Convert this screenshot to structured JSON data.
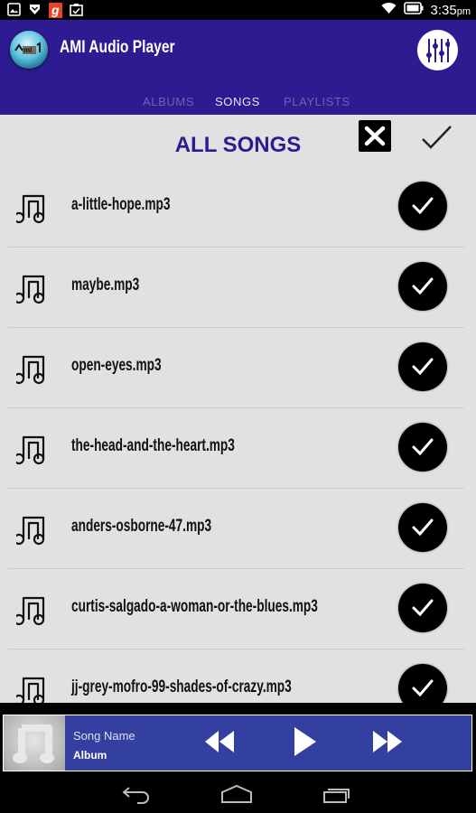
{
  "status_bar": {
    "left_icons": [
      "image-icon",
      "download-shield-icon",
      "gaana-app-icon",
      "clipboard-check-icon"
    ],
    "right_icons": [
      "wifi-icon",
      "battery-icon"
    ],
    "time": "3:35",
    "ampm": "pm"
  },
  "app_bar": {
    "title": "AMI Audio Player",
    "logo_text": "AMI",
    "equalizer_icon": "equalizer-icon"
  },
  "tabs": [
    {
      "label": "ALBUMS",
      "active": false
    },
    {
      "label": "SONGS",
      "active": true
    },
    {
      "label": "PLAYLISTS",
      "active": false
    }
  ],
  "content": {
    "title": "ALL SONGS",
    "close_icon": "close-icon",
    "confirm_icon": "check-icon"
  },
  "songs": [
    {
      "name": "a-little-hope.mp3",
      "selected": true
    },
    {
      "name": "maybe.mp3",
      "selected": true
    },
    {
      "name": "open-eyes.mp3",
      "selected": true
    },
    {
      "name": "the-head-and-the-heart.mp3",
      "selected": true
    },
    {
      "name": "anders-osborne-47.mp3",
      "selected": true
    },
    {
      "name": "curtis-salgado-a-woman-or-the-blues.mp3",
      "selected": true
    },
    {
      "name": "jj-grey-mofro-99-shades-of-crazy.mp3",
      "selected": true
    }
  ],
  "player": {
    "song_name": "Song Name",
    "album": "Album",
    "controls": [
      "rewind-icon",
      "play-icon",
      "fast-forward-icon"
    ]
  },
  "nav_bar": {
    "buttons": [
      "back-icon",
      "home-icon",
      "recents-icon"
    ]
  },
  "colors": {
    "primary": "#2e1b91",
    "player_bg": "#3340a0",
    "content_bg": "#e1e1e1"
  }
}
